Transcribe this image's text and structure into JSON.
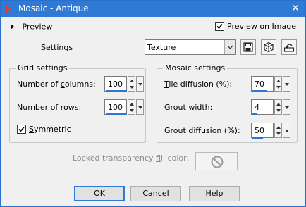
{
  "window": {
    "title": "Mosaic - Antique",
    "close_glyph": "✕"
  },
  "preview": {
    "label": "Preview",
    "preview_on_image_label": "Preview on Image",
    "preview_on_image_checked": true
  },
  "settings": {
    "label": "Settings",
    "preset_value": "Texture",
    "icons": [
      "save-preset-icon",
      "randomize-icon",
      "reset-icon"
    ]
  },
  "grid_settings": {
    "title": "Grid settings",
    "columns_label": "Number of columns:",
    "columns_value": "100",
    "rows_label": "Number of rows:",
    "rows_value": "100",
    "symmetric_label": "Symmetric",
    "symmetric_checked": true
  },
  "mosaic_settings": {
    "title": "Mosaic settings",
    "tile_diffusion_label": "Tile diffusion (%):",
    "tile_diffusion_value": "70",
    "grout_width_label": "Grout width:",
    "grout_width_value": "4",
    "grout_diffusion_label": "Grout diffusion (%):",
    "grout_diffusion_value": "50"
  },
  "locked_fill": {
    "label": "Locked transparency fill color:"
  },
  "buttons": {
    "ok": "OK",
    "cancel": "Cancel",
    "help": "Help"
  },
  "colors": {
    "titlebar": "#2f7ad5",
    "accent": "#2f76cc"
  }
}
